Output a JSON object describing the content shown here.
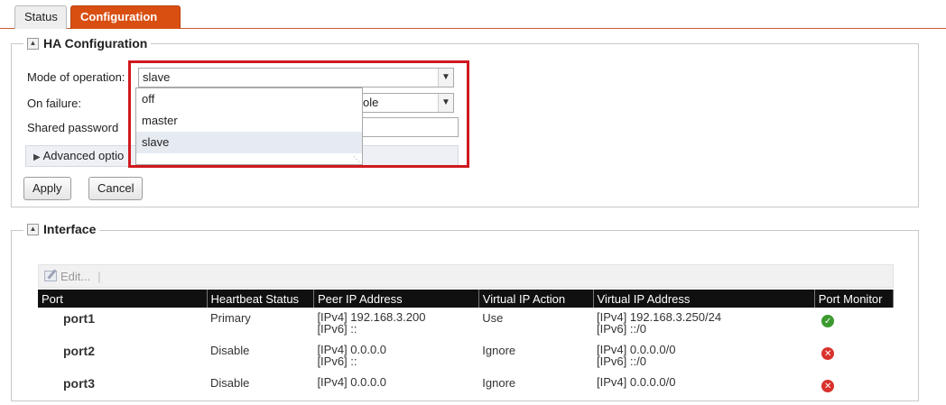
{
  "tabs": [
    {
      "label": "Status"
    },
    {
      "label": "Configuration"
    }
  ],
  "ha_config": {
    "title": "HA Configuration",
    "mode_label": "Mode of operation:",
    "mode_value": "slave",
    "mode_options": [
      "off",
      "master",
      "slave"
    ],
    "on_failure_label": "On failure:",
    "on_failure_value": "ole",
    "shared_password_label": "Shared password",
    "advanced_label": "Advanced optio",
    "apply_label": "Apply",
    "cancel_label": "Cancel"
  },
  "interface": {
    "title": "Interface",
    "toolbar_edit": "Edit...",
    "toolbar_sep": "|",
    "columns": [
      "Port",
      "Heartbeat Status",
      "Peer IP Address",
      "Virtual IP Action",
      "Virtual IP Address",
      "Port Monitor"
    ],
    "rows": [
      {
        "port": "port1",
        "heartbeat": "Primary",
        "peer_ipv4": "[IPv4] 192.168.3.200",
        "peer_ipv6": "[IPv6] ::",
        "vip_action": "Use",
        "vip_ipv4": "[IPv4] 192.168.3.250/24",
        "vip_ipv6": "[IPv6] ::/0",
        "monitor": "ok"
      },
      {
        "port": "port2",
        "heartbeat": "Disable",
        "peer_ipv4": "[IPv4] 0.0.0.0",
        "peer_ipv6": "[IPv6] ::",
        "vip_action": "Ignore",
        "vip_ipv4": "[IPv4] 0.0.0.0/0",
        "vip_ipv6": "[IPv6] ::/0",
        "monitor": "error"
      },
      {
        "port": "port3",
        "heartbeat": "Disable",
        "peer_ipv4": "[IPv4] 0.0.0.0",
        "peer_ipv6": "",
        "vip_action": "Ignore",
        "vip_ipv4": "[IPv4] 0.0.0.0/0",
        "vip_ipv6": "",
        "monitor": "error"
      }
    ]
  },
  "colors": {
    "accent_tab": "#d94f12",
    "highlight_border": "#d0191f",
    "table_header": "#101010",
    "monitor_ok": "#3c9a2f",
    "monitor_error": "#d9322c"
  },
  "icons": {
    "collapse": "collapse-icon",
    "expand_triangle": "expand-triangle-icon",
    "edit": "edit-icon",
    "dropdown_arrow": "chevron-down-icon",
    "monitor_ok": "check-circle-icon",
    "monitor_error": "x-circle-icon"
  }
}
